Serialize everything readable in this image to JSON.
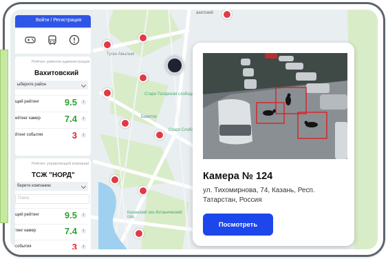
{
  "topbar": {
    "login_label": "Войти / Регистрация"
  },
  "icons": [
    "gamepad-icon",
    "bus-icon",
    "alert-icon"
  ],
  "colors": {
    "accent": "#1d47ea",
    "good": "#2fa12f",
    "bad": "#e02424",
    "pin": "#e23a45"
  },
  "district_card": {
    "caption": "Рейтинг районов администрации",
    "name": "Вахитовский",
    "select_label": "ыберите район",
    "metrics": [
      {
        "label": "щий рейтинг",
        "value": "9.5",
        "status": "good"
      },
      {
        "label": "ейтинг камер",
        "value": "7.4",
        "status": "good"
      },
      {
        "label": "йтинг события",
        "value": "3",
        "status": "bad"
      }
    ]
  },
  "company_card": {
    "caption": "Рейтинг управляющей компании",
    "name": "ТСЖ \"НОРД\"",
    "select_label": "берите компанию",
    "search_placeholder": "Поиск",
    "metrics": [
      {
        "label": "щий рейтинг",
        "value": "9.5",
        "status": "good"
      },
      {
        "label": "тинг камер",
        "value": "7.4",
        "status": "good"
      },
      {
        "label": "события",
        "value": "3",
        "status": "bad"
      }
    ]
  },
  "map": {
    "labels": {
      "top": "ахитский",
      "tugan": "Туган Авылым",
      "sloboda": "Старо-Татарская слобода",
      "berezka": "Бахетле",
      "gerbera": "Старо Слобо",
      "zoo": "Казанский зоо-ботанический сад"
    }
  },
  "popup": {
    "title": "Камера № 124",
    "address": "ул. Тихомирнова, 74, Казань, Респ. Татарстан, Россия",
    "button_label": "Посмотреть"
  }
}
